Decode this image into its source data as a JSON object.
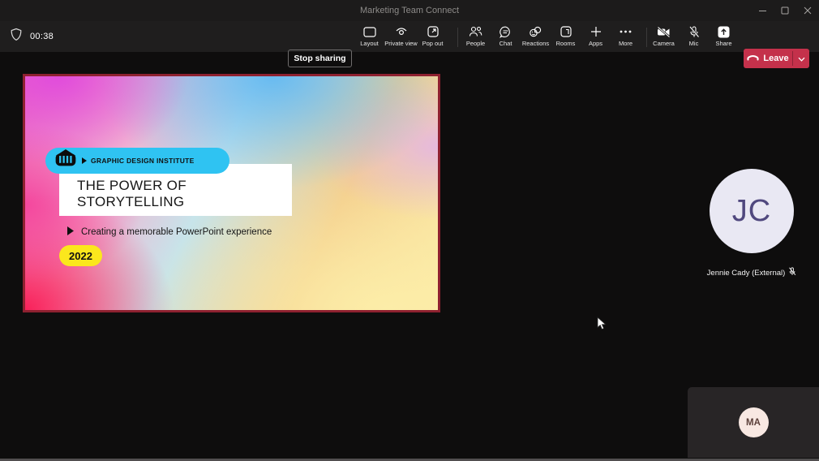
{
  "window": {
    "title": "Marketing Team Connect",
    "controls": {
      "minimize": "minimize",
      "maximize": "maximize",
      "close": "close"
    }
  },
  "toolbar": {
    "timer": "00:38",
    "stop_sharing": "Stop sharing",
    "layout": "Layout",
    "private_view": "Private view",
    "pop_out": "Pop out",
    "people": "People",
    "chat": "Chat",
    "reactions": "Reactions",
    "rooms": "Rooms",
    "apps": "Apps",
    "more": "More",
    "camera": "Camera",
    "mic": "Mic",
    "share": "Share",
    "leave": "Leave"
  },
  "slide": {
    "badge_label": "GRAPHIC DESIGN INSTITUTE",
    "title": "THE POWER OF STORYTELLING",
    "subtitle": "Creating a memorable PowerPoint experience",
    "year_badge": "2022"
  },
  "participants": {
    "remote": {
      "initials": "JC",
      "name": "Jennie Cady (External)",
      "muted": true
    },
    "self": {
      "initials": "MA"
    }
  },
  "icons": {
    "left": [
      "shield-icon"
    ],
    "view": [
      "layout-icon",
      "eye-icon",
      "popout-icon"
    ],
    "meeting": [
      "people-icon",
      "chat-icon",
      "reactions-icon",
      "rooms-icon",
      "plus-icon",
      "ellipsis-icon"
    ],
    "devices": [
      "camera-off-icon",
      "mic-off-icon",
      "share-tray-icon"
    ],
    "leave": [
      "phone-hangup-icon",
      "chevron-down-icon"
    ],
    "slide": [
      "bank-icon",
      "play-triangle-icon"
    ],
    "other": [
      "mic-off-small-icon",
      "mouse-cursor-icon"
    ]
  },
  "colors": {
    "leave_red": "#c4314b",
    "share_frame_red": "#8e2130",
    "badge_cyan": "#2fc3f2",
    "badge_yellow": "#fbe71d",
    "remote_avatar_bg": "#e9e8f3",
    "remote_avatar_text": "#50487e",
    "self_avatar_bg": "#f8e8e2",
    "self_avatar_text": "#5c403a",
    "titlebar_bg": "#1c1b1b",
    "toolbar_bg": "#1f1e1e",
    "canvas_bg": "#0e0d0d"
  }
}
